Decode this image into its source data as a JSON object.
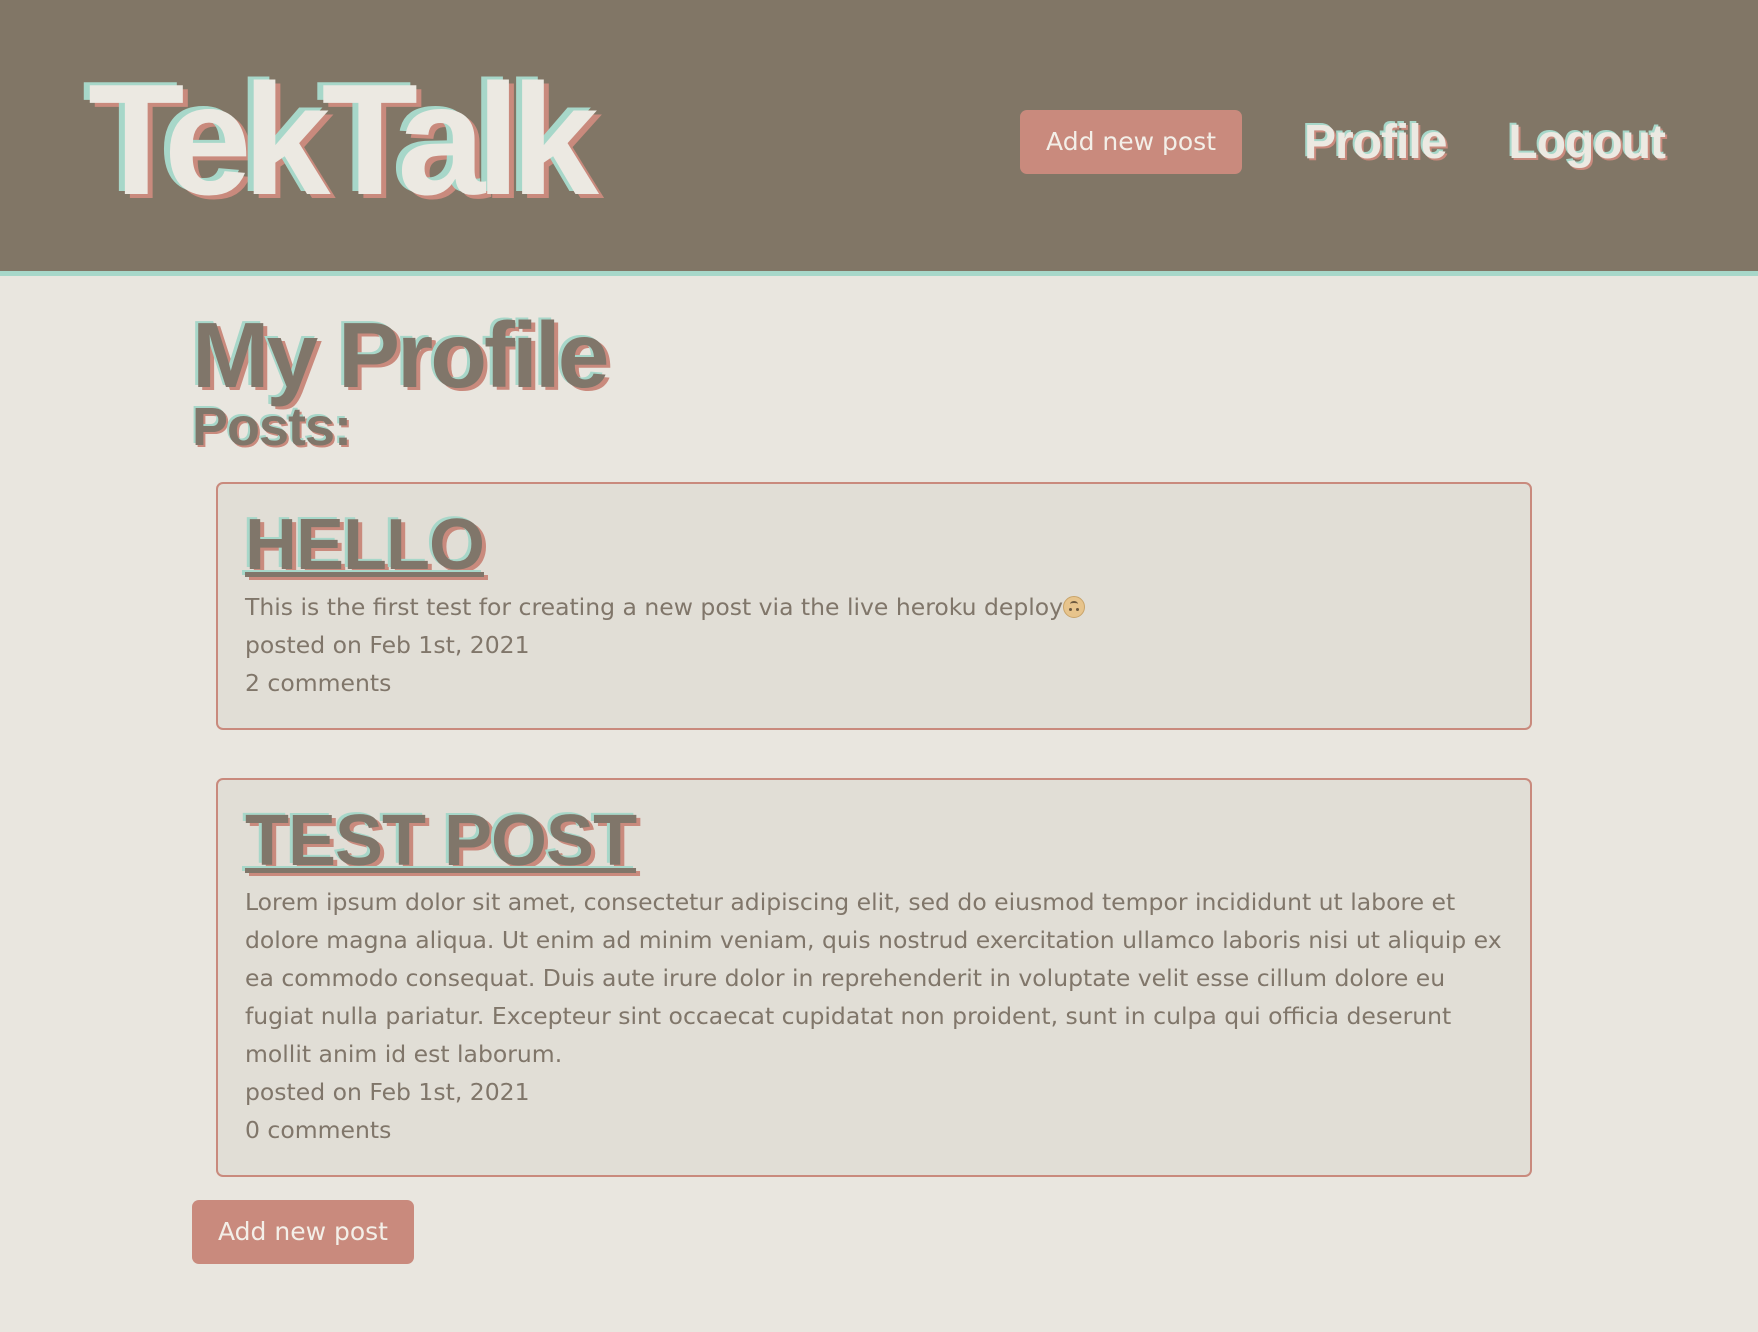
{
  "header": {
    "logo": "TekTalk",
    "nav": {
      "add_post": "Add new post",
      "profile": "Profile",
      "logout": "Logout"
    }
  },
  "main": {
    "title": "My Profile",
    "posts_heading": "Posts:",
    "posts": [
      {
        "title": "HELLO",
        "body": "This is the first test for creating a new post via the live heroku deploy",
        "emoji": "upside-down-face-icon",
        "date": "posted on Feb 1st, 2021",
        "comments": "2 comments"
      },
      {
        "title": "TEST POST",
        "body": "Lorem ipsum dolor sit amet, consectetur adipiscing elit, sed do eiusmod tempor incididunt ut labore et dolore magna aliqua. Ut enim ad minim veniam, quis nostrud exercitation ullamco laboris nisi ut aliquip ex ea commodo consequat. Duis aute irure dolor in reprehenderit in voluptate velit esse cillum dolore eu fugiat nulla pariatur. Excepteur sint occaecat cupidatat non proident, sunt in culpa qui officia deserunt mollit anim id est laborum.",
        "date": "posted on Feb 1st, 2021",
        "comments": "0 comments"
      }
    ],
    "add_post": "Add new post"
  },
  "colors": {
    "header_bg": "#817666",
    "page_bg": "#e9e6df",
    "accent": "#c98a7d",
    "mint": "#a7d7c9",
    "text": "#80766a"
  }
}
